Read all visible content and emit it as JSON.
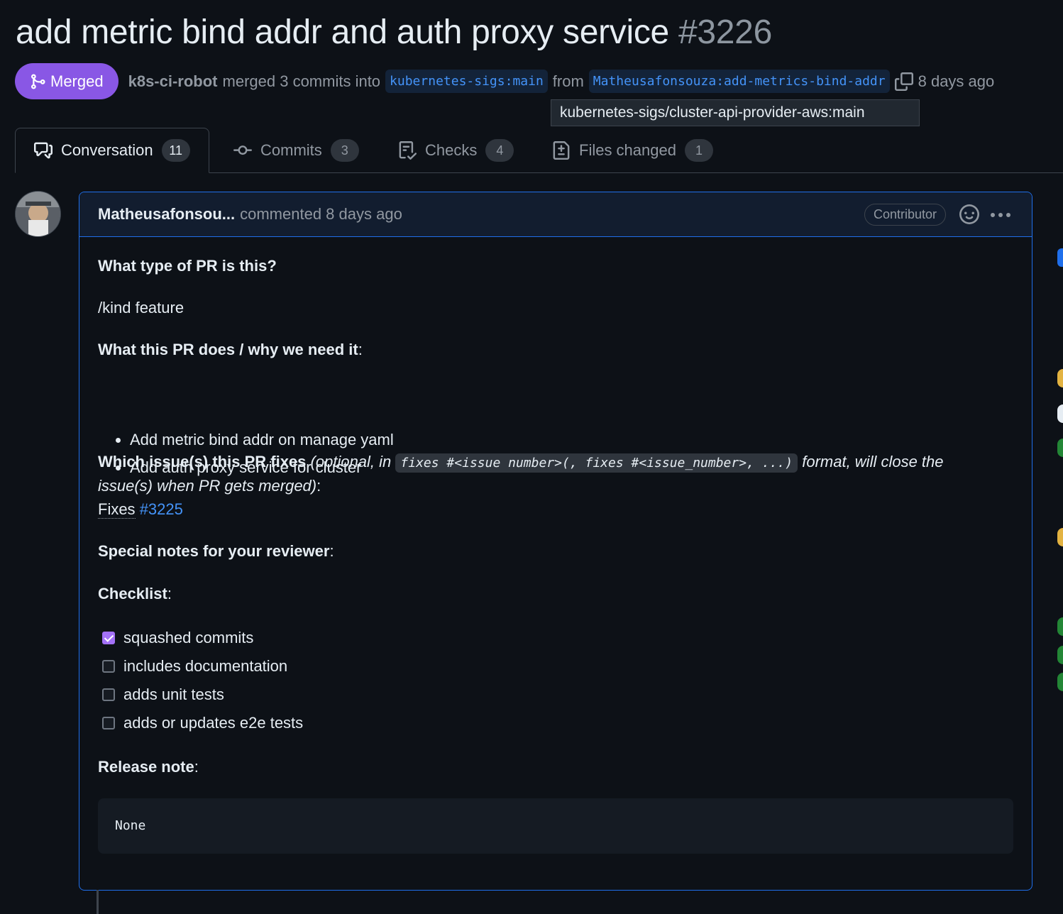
{
  "pr": {
    "title": "add metric bind addr and auth proxy service",
    "number": "#3226",
    "status": "Merged",
    "merged_by": "k8s-ci-robot",
    "merge_text": "merged 3 commits into",
    "base_branch": "kubernetes-sigs:main",
    "from_text": "from",
    "head_branch": "Matheusafonsouza:add-metrics-bind-addr",
    "time": "8 days ago",
    "tooltip": "kubernetes-sigs/cluster-api-provider-aws:main"
  },
  "tabs": [
    {
      "label": "Conversation",
      "count": "11",
      "icon": "comment-discussion-icon"
    },
    {
      "label": "Commits",
      "count": "3",
      "icon": "git-commit-icon"
    },
    {
      "label": "Checks",
      "count": "4",
      "icon": "checklist-icon"
    },
    {
      "label": "Files changed",
      "count": "1",
      "icon": "file-diff-icon"
    }
  ],
  "comment": {
    "author": "Matheusafonsou...",
    "action": "commented 8 days ago",
    "role_badge": "Contributor",
    "h_type": "What type of PR is this?",
    "kind": "/kind feature",
    "h_does": "What this PR does / why we need it",
    "colon": ":",
    "bullets": [
      "Add metric bind addr on manage yaml",
      "Add auth proxy service for cluster"
    ],
    "h_fixes": "Which issue(s) this PR fixes",
    "fixes_note_a": "(optional, in",
    "fixes_code": "fixes #<issue number>(, fixes #<issue_number>, ...)",
    "fixes_note_b": "format, will close the",
    "fixes_note_c": "issue(s) when PR gets merged)",
    "fixes_label": "Fixes",
    "fixes_link": "#3225",
    "h_notes": "Special notes for your reviewer",
    "h_checklist": "Checklist",
    "tasks": [
      {
        "label": "squashed commits",
        "checked": true
      },
      {
        "label": "includes documentation",
        "checked": false
      },
      {
        "label": "adds unit tests",
        "checked": false
      },
      {
        "label": "adds or updates e2e tests",
        "checked": false
      }
    ],
    "h_release": "Release note",
    "release_note": "None"
  },
  "colors": {
    "merged": "#8957e5",
    "link": "#4493f8",
    "accent_border": "#1f6feb",
    "checkbox": "#a371f7"
  }
}
